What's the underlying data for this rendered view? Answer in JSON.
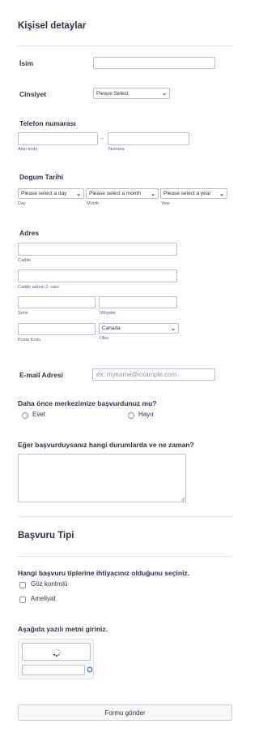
{
  "section_personal": {
    "title": "Kişisel detaylar"
  },
  "name": {
    "label": "İsim"
  },
  "gender": {
    "label": "Cinsiyet",
    "selected": "Please Select"
  },
  "phone": {
    "label": "Telefon numarası",
    "area_sub": "Alan kodu",
    "dash": "-",
    "number_sub": "Numara"
  },
  "birth": {
    "label": "Dogum Tarihi",
    "day_select": "Please select a day",
    "month_select": "Please select a month",
    "year_select": "Please select a year",
    "day_sub": "Day",
    "month_sub": "Month",
    "year_sub": "Year"
  },
  "address": {
    "label": "Adres",
    "street_sub": "Cadde",
    "street2_sub": "Cadde adresi 2. satır",
    "city_sub": "Şehir",
    "state_sub": "İl/Eyalet",
    "postal_sub": "Posta Kodu",
    "country_selected": "Canada",
    "country_sub": "Ülke"
  },
  "email": {
    "label": "E-mail Adresi",
    "placeholder": "ex: myname@example.com"
  },
  "applied_before": {
    "question": "Daha önce merkezimize başvurdunuz mu?",
    "options": [
      "Evet",
      "Hayır"
    ]
  },
  "when": {
    "question": "Eğer başvurduysanız hangi durumlarda ve ne zaman?"
  },
  "section_type": {
    "title": "Başvuru Tipi"
  },
  "types": {
    "question": "Hangi başvuru tiplerine ihtiyacınız olduğunu seçiniz.",
    "options": [
      "Göz kontrolü",
      "Ameliyat"
    ]
  },
  "captcha": {
    "label": "Aşağıda yazılı metni giriniz."
  },
  "submit": {
    "label": "Formu gönder"
  },
  "icons": {
    "chevron": "chevron-down-icon",
    "reload": "reload-icon",
    "spinner": "loading-spinner-icon"
  }
}
